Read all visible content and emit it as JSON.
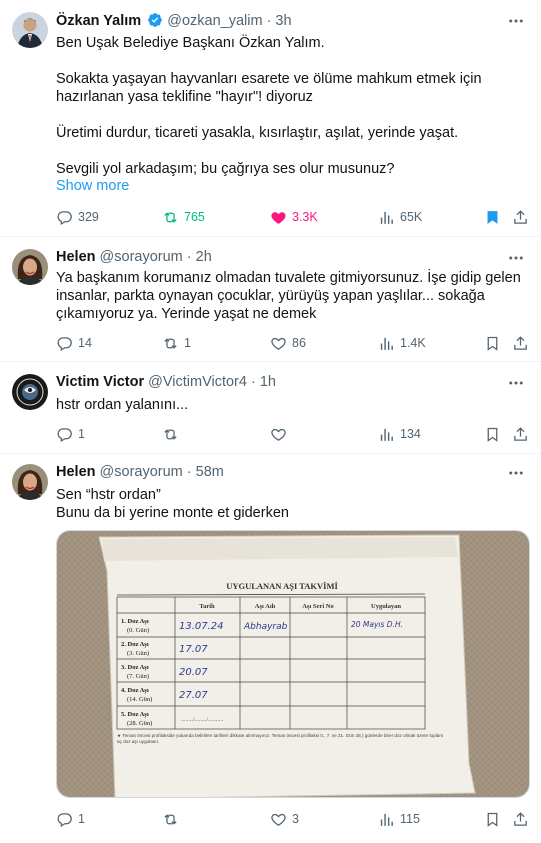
{
  "tweets": [
    {
      "name": "Özkan Yalım",
      "handle": "@ozkan_yalim",
      "time": "· 3h",
      "lines": [
        "Ben Uşak Belediye Başkanı Özkan Yalım.",
        "",
        "Sokakta yaşayan hayvanları esarete ve ölüme mahkum etmek için",
        "hazırlanan yasa teklifine  \"hayır\"! diyoruz",
        "",
        "Üretimi durdur, ticareti yasakla, kısırlaştır, aşılat, yerinde yaşat.",
        "",
        "Sevgili yol arkadaşım; bu çağrıya ses olur musunuz?"
      ],
      "show_more": "Show more",
      "replies": "329",
      "retweets": "765",
      "likes": "3.3K",
      "views": "65K"
    },
    {
      "name": "Helen",
      "handle": "@sorayorum",
      "time": "· 2h",
      "lines": [
        "Ya başkanım korumanız olmadan tuvalete gitmiyorsunuz. İşe gidip gelen",
        "insanlar, parkta oynayan çocuklar, yürüyüş yapan yaşlılar... sokağa",
        "çıkamıyoruz ya. Yerinde yaşat ne demek"
      ],
      "replies": "14",
      "retweets": "1",
      "likes": "86",
      "views": "1.4K"
    },
    {
      "name": "Victim Victor",
      "handle": "@VictimVictor4",
      "time": "· 1h",
      "lines": [
        "hstr ordan yalanını..."
      ],
      "replies": "1",
      "retweets": "",
      "likes": "",
      "views": "134"
    },
    {
      "name": "Helen",
      "handle": "@sorayorum",
      "time": "· 58m",
      "lines": [
        "Sen “hstr ordan”",
        "Bunu da bi yerine monte et giderken"
      ],
      "replies": "1",
      "retweets": "",
      "likes": "3",
      "views": "115"
    }
  ],
  "vaccine_card": {
    "title": "UYGULANAN AŞI TAKVİMİ",
    "columns": [
      "Tarih",
      "Aşı Adı",
      "Aşı Seri No",
      "Uygulayan"
    ],
    "rows": [
      {
        "dose": "1. Doz Aşı",
        "day": "(0. Gün)",
        "date": "13.07.24",
        "vaccine": "Abhayrab",
        "serial": "",
        "by": "20 Mayıs D.H."
      },
      {
        "dose": "2. Doz Aşı",
        "day": "(3. Gün)",
        "date": "17.07",
        "vaccine": "",
        "serial": "",
        "by": ""
      },
      {
        "dose": "3. Doz Aşı",
        "day": "(7. Gün)",
        "date": "20.07",
        "vaccine": "",
        "serial": "",
        "by": ""
      },
      {
        "dose": "4. Doz Aşı",
        "day": "(14. Gün)",
        "date": "27.07",
        "vaccine": "",
        "serial": "",
        "by": ""
      },
      {
        "dose": "5. Doz Aşı",
        "day": "(28. Gün)",
        "date": "......../......../..........",
        "vaccine": "",
        "serial": "",
        "by": ""
      }
    ],
    "footnote": "★ Temas öncesi profilakside yukarıda belirtilen tarihleri dikkate alınmayınız. Temas öncesi profilaksi 0., 7. ve 21. Gün 28.) günlerde birer doz olmak üzere toplam üç doz aşı uygulanır."
  },
  "colors": {
    "accent": "#1d9bf0",
    "retweet_active": "#00ba7c",
    "like_active": "#f91880",
    "muted": "#536471",
    "verified": "#1d9bf0"
  }
}
